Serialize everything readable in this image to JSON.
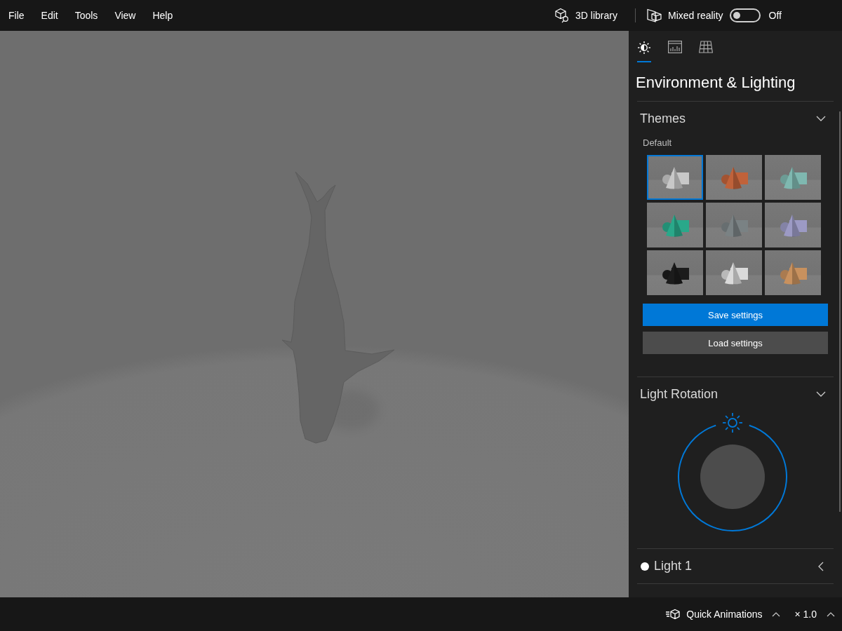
{
  "menu_bar": {
    "items": [
      "File",
      "Edit",
      "Tools",
      "View",
      "Help"
    ],
    "library_label": "3D library",
    "mixed_reality": {
      "label": "Mixed reality",
      "on": false,
      "state_text": "Off"
    }
  },
  "panel": {
    "tabs": [
      {
        "kind": "lighting",
        "selected": true
      },
      {
        "kind": "stats",
        "selected": false
      },
      {
        "kind": "grid",
        "selected": false
      }
    ],
    "title": "Environment & Lighting",
    "themes_section": {
      "title": "Themes",
      "expanded": true,
      "group_label": "Default",
      "themes": [
        {
          "color": "#c8c8c8",
          "selected": true
        },
        {
          "color": "#c0623a",
          "selected": false
        },
        {
          "color": "#7fb8b0",
          "selected": false
        },
        {
          "color": "#2aa88a",
          "selected": false
        },
        {
          "color": "#7a8284",
          "selected": false
        },
        {
          "color": "#9c9ac4",
          "selected": false
        },
        {
          "color": "#1c1c1c",
          "selected": false
        },
        {
          "color": "#dadada",
          "selected": false
        },
        {
          "color": "#c8915e",
          "selected": false
        }
      ],
      "buttons": [
        {
          "label": "Save settings",
          "kind": "primary"
        },
        {
          "label": "Load settings",
          "kind": "secondary"
        }
      ]
    },
    "light_rotation_section": {
      "title": "Light Rotation",
      "expanded": true
    },
    "lights": [
      {
        "label": "Light 1",
        "color": "#ffffff",
        "expanded": false
      }
    ]
  },
  "status_bar": {
    "animations_label": "Quick Animations",
    "speed": "× 1.0"
  }
}
